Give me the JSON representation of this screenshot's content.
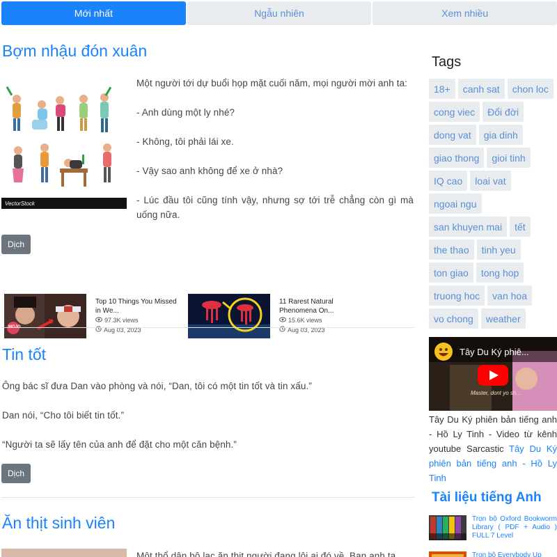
{
  "tabs": [
    {
      "label": "Mới nhất",
      "active": true
    },
    {
      "label": "Ngẫu nhiên",
      "active": false
    },
    {
      "label": "Xem nhiều",
      "active": false
    }
  ],
  "posts": [
    {
      "title": "Bợm nhậu đón xuân",
      "image_caption": "VectorStock",
      "paragraphs": [
        "Một người tới dự buổi họp mặt cuối năm, mọi người mời anh ta:",
        "- Anh dùng một ly nhé?",
        "- Không, tôi phải lái xe.",
        "- Vậy sao anh không để xe ở nhà?",
        "- Lúc đầu tôi cũng tính vậy, nhưng sợ tới trễ chẳng còn gì mà uống nữa."
      ],
      "button": "Dịch"
    },
    {
      "title": "Tin tốt",
      "paragraphs": [
        "Ông bác sĩ đưa Dan vào phòng và nói, “Dan, tôi có một tin tốt và tin xấu.”",
        "Dan nói, “Cho tôi biết tin tốt.”",
        "“Người ta sẽ lấy tên của anh để đặt cho một căn bệnh.”"
      ],
      "button": "Dịch"
    },
    {
      "title": "Ăn thịt sinh viên",
      "paragraphs": [
        "Một thổ dân bộ lạc ăn thịt người đang lôi ai đó về. Bạn anh ta"
      ]
    }
  ],
  "video_cards": [
    {
      "title": "Top 10 Things You Missed in We...",
      "views": "97.3K views",
      "date": "Aug 03, 2023",
      "thumb_label": "MOJO"
    },
    {
      "title": "11 Rarest Natural Phenomena On...",
      "views": "15.6K views",
      "date": "Aug 03, 2023"
    }
  ],
  "sidebar": {
    "tags_heading": "Tags",
    "tags": [
      "18+",
      "canh sat",
      "chon loc",
      "cong viec",
      "Đổi đời",
      "dong vat",
      "gia dinh",
      "giao thong",
      "gioi tinh",
      "IQ cao",
      "loai vat",
      "ngoai ngu",
      "san khuyen mai",
      "tết",
      "the thao",
      "tinh yeu",
      "ton giao",
      "tong hop",
      "truong hoc",
      "van hoa",
      "vo chong",
      "weather"
    ],
    "video": {
      "title": "Tây Du Ký phiê...",
      "subtitle_text": "Master, dont yo sh..."
    },
    "video_desc_prefix": "Tây Du Ký phiên bản tiếng anh - Hồ Ly Tinh - Video từ kênh youtube Sarcastic",
    "video_desc_link": "Tây Du Ký phiên bản tiếng anh - Hồ Ly Tinh",
    "docs_heading": "Tài liệu tiếng Anh",
    "docs": [
      "Trọn bộ Oxford Bookworm Library ( PDF + Audio ) FULL 7 Level",
      "Trọn bộ Everybody Up"
    ]
  },
  "colors": {
    "accent": "#1a82fb",
    "tag_bg": "#e9ecef",
    "button_gray": "#6c757d"
  }
}
